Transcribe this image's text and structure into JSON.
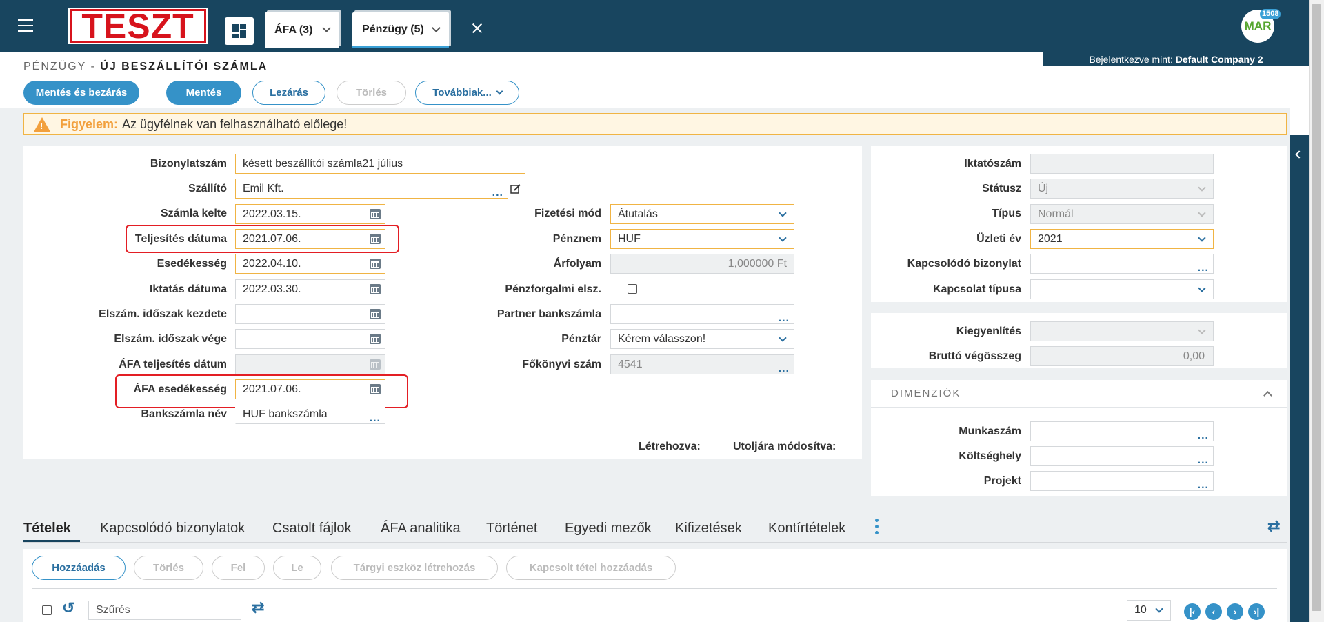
{
  "app": {
    "logo_text": "TESZT",
    "avatar_text": "MAR",
    "avatar_badge": "1508",
    "login_prefix": "Bejelentkezve mint:",
    "login_company": "Default Company 2"
  },
  "module_tabs": [
    {
      "label": "ÁFA (3)"
    },
    {
      "label": "Pénzügy (5)"
    }
  ],
  "breadcrumb": {
    "section": "PÉNZÜGY -",
    "page": "ÚJ BESZÁLLÍTÓI SZÁMLA"
  },
  "toolbar": {
    "save_close": "Mentés és bezárás",
    "save": "Mentés",
    "lock": "Lezárás",
    "delete": "Törlés",
    "more": "Továbbiak..."
  },
  "warning": {
    "title": "Figyelem:",
    "text": "Az ügyfélnek van felhasználható előlege!"
  },
  "form_left": {
    "bizonylatszam": {
      "label": "Bizonylatszám",
      "value": "késett beszállítói számla21 július"
    },
    "szallito": {
      "label": "Szállító",
      "value": "Emil Kft."
    },
    "szamla_kelte": {
      "label": "Számla kelte",
      "value": "2022.03.15."
    },
    "teljesites_datuma": {
      "label": "Teljesítés dátuma",
      "value": "2021.07.06."
    },
    "esedekesseg": {
      "label": "Esedékesség",
      "value": "2022.04.10."
    },
    "iktatas_datuma": {
      "label": "Iktatás dátuma",
      "value": "2022.03.30."
    },
    "elszam_kezdete": {
      "label": "Elszám. időszak kezdete",
      "value": ""
    },
    "elszam_vege": {
      "label": "Elszám. időszak vége",
      "value": ""
    },
    "afa_teljesites": {
      "label": "ÁFA teljesítés dátum",
      "value": ""
    },
    "afa_esedekesseg": {
      "label": "ÁFA esedékesség",
      "value": "2021.07.06."
    },
    "bankszamla_nev": {
      "label": "Bankszámla név",
      "value": "HUF bankszámla"
    }
  },
  "form_mid": {
    "fizetesi_mod": {
      "label": "Fizetési mód",
      "value": "Átutalás"
    },
    "penznem": {
      "label": "Pénznem",
      "value": "HUF"
    },
    "arfolyam": {
      "label": "Árfolyam",
      "value": "1,000000 Ft"
    },
    "penzforgalmi": {
      "label": "Pénzforgalmi elsz.",
      "checked": false
    },
    "partner_bankszamla": {
      "label": "Partner bankszámla",
      "value": ""
    },
    "penztar": {
      "label": "Pénztár",
      "value": "Kérem válasszon!"
    },
    "fokonyvi_szam": {
      "label": "Főkönyvi szám",
      "value": "4541"
    },
    "letrehozva": "Létrehozva:",
    "utoljara": "Utoljára módosítva:"
  },
  "form_right": {
    "iktatoszam": {
      "label": "Iktatószám",
      "value": ""
    },
    "statusz": {
      "label": "Státusz",
      "value": "Új"
    },
    "tipus": {
      "label": "Típus",
      "value": "Normál"
    },
    "uzleti_ev": {
      "label": "Üzleti év",
      "value": "2021"
    },
    "kapcsolodo": {
      "label": "Kapcsolódó bizonylat",
      "value": ""
    },
    "kapcsolat_tipusa": {
      "label": "Kapcsolat típusa",
      "value": ""
    },
    "kiegyenlites": {
      "label": "Kiegyenlítés",
      "value": ""
    },
    "brutto": {
      "label": "Bruttó végösszeg",
      "value": "0,00"
    }
  },
  "dimensions": {
    "title": "DIMENZIÓK",
    "munkaszam": {
      "label": "Munkaszám",
      "value": ""
    },
    "koltseghely": {
      "label": "Költséghely",
      "value": ""
    },
    "projekt": {
      "label": "Projekt",
      "value": ""
    }
  },
  "detail_tabs": [
    "Tételek",
    "Kapcsolódó bizonylatok",
    "Csatolt fájlok",
    "ÁFA analitika",
    "Történet",
    "Egyedi mezők",
    "Kifizetések",
    "Kontírtételek"
  ],
  "grid": {
    "add": "Hozzáadás",
    "delete": "Törlés",
    "up": "Fel",
    "down": "Le",
    "asset": "Tárgyi eszköz létrehozás",
    "linked": "Kapcsolt tétel hozzáadás",
    "filter_placeholder": "Szűrés",
    "page_size": "10"
  },
  "colors": {
    "header": "#18455f",
    "accent": "#3592c8",
    "warning": "#f2a03d",
    "highlight": "#e31e24"
  }
}
